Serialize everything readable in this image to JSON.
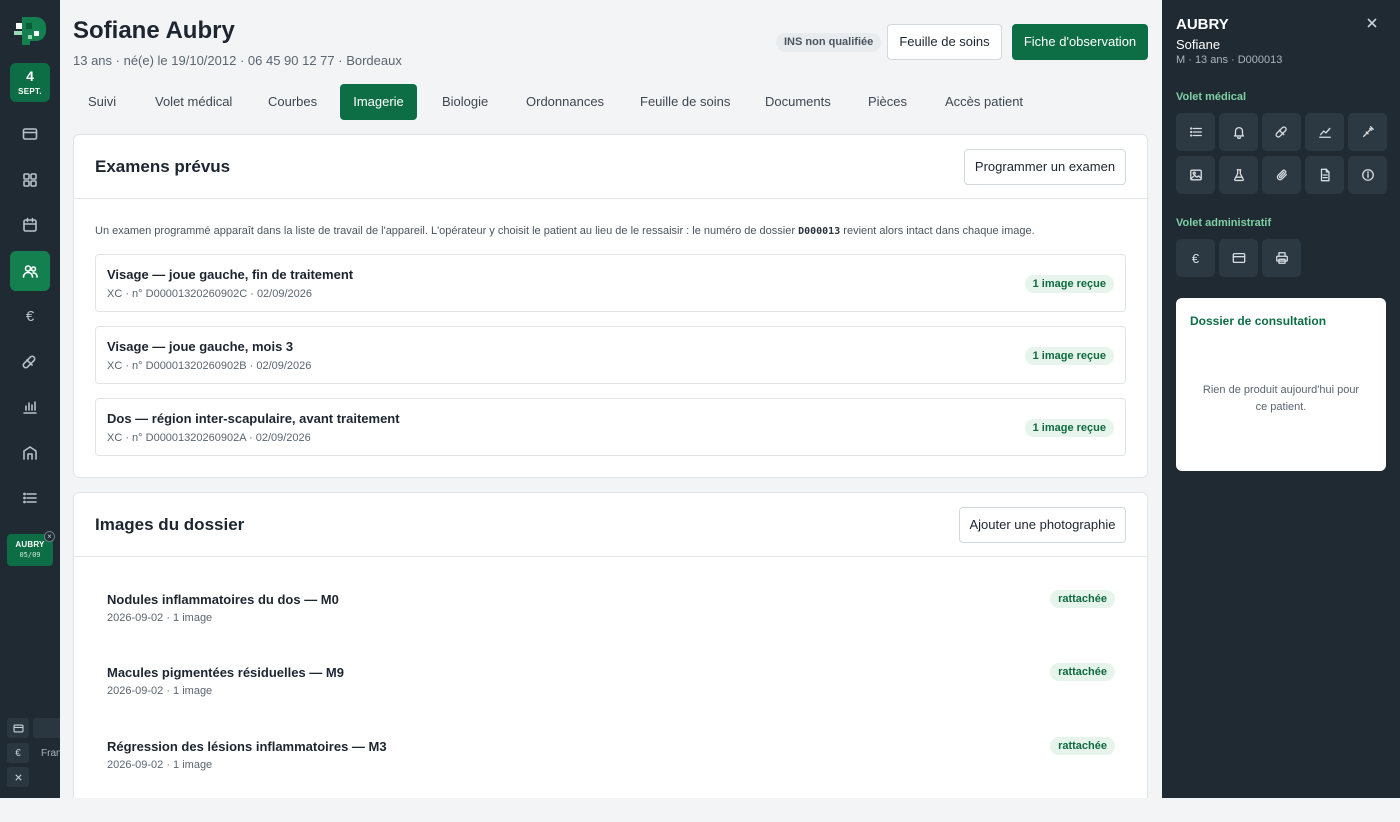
{
  "rail": {
    "date_day": "4",
    "date_month": "SEPT.",
    "mini_patient_name": "AUBRY",
    "mini_patient_date": "05/09",
    "language": "Français"
  },
  "header": {
    "patient_name": "Sofiane Aubry",
    "patient_info": "13 ans · né(e) le 19/10/2012 · 06 45 90 12 77 · Bordeaux",
    "ins_badge": "INS non qualifiée",
    "care_sheet_button": "Feuille de soins",
    "observation_button": "Fiche d'observation"
  },
  "tabs": [
    {
      "label": "Suivi"
    },
    {
      "label": "Volet médical"
    },
    {
      "label": "Courbes"
    },
    {
      "label": "Imagerie"
    },
    {
      "label": "Biologie"
    },
    {
      "label": "Ordonnances"
    },
    {
      "label": "Feuille de soins"
    },
    {
      "label": "Documents"
    },
    {
      "label": "Pièces"
    },
    {
      "label": "Accès patient"
    }
  ],
  "exams": {
    "title": "Examens prévus",
    "button": "Programmer un examen",
    "hint_before": "Un examen programmé apparaît dans la liste de travail de l'appareil. L'opérateur y choisit le patient au lieu de le ressaisir : le numéro de dossier ",
    "hint_code": "D000013",
    "hint_after": " revient alors intact dans chaque image.",
    "items": [
      {
        "title": "Visage — joue gauche, fin de traitement",
        "sub": "XC · n° D00001320260902C · 02/09/2026",
        "status": "1 image reçue"
      },
      {
        "title": "Visage — joue gauche, mois 3",
        "sub": "XC · n° D00001320260902B · 02/09/2026",
        "status": "1 image reçue"
      },
      {
        "title": "Dos — région inter-scapulaire, avant traitement",
        "sub": "XC · n° D00001320260902A · 02/09/2026",
        "status": "1 image reçue"
      }
    ]
  },
  "images": {
    "title": "Images du dossier",
    "button": "Ajouter une photographie",
    "items": [
      {
        "title": "Nodules inflammatoires du dos — M0",
        "sub": "2026-09-02 · 1 image",
        "status": "rattachée"
      },
      {
        "title": "Macules pigmentées résiduelles — M9",
        "sub": "2026-09-02 · 1 image",
        "status": "rattachée"
      },
      {
        "title": "Régression des lésions inflammatoires — M3",
        "sub": "2026-09-02 · 1 image",
        "status": "rattachée"
      }
    ]
  },
  "side": {
    "last_name": "AUBRY",
    "first_name": "Sofiane",
    "meta": "M · 13 ans · D000013",
    "medical_section": "Volet médical",
    "admin_section": "Volet administratif",
    "consult_title": "Dossier de consultation",
    "consult_empty": "Rien de produit aujourd'hui pour ce patient."
  },
  "colors": {
    "brand_green": "#0d6e45",
    "dark_panel": "#1f2a33",
    "section_green": "#7ed0a4",
    "pill_bg": "#e7f4ec"
  }
}
